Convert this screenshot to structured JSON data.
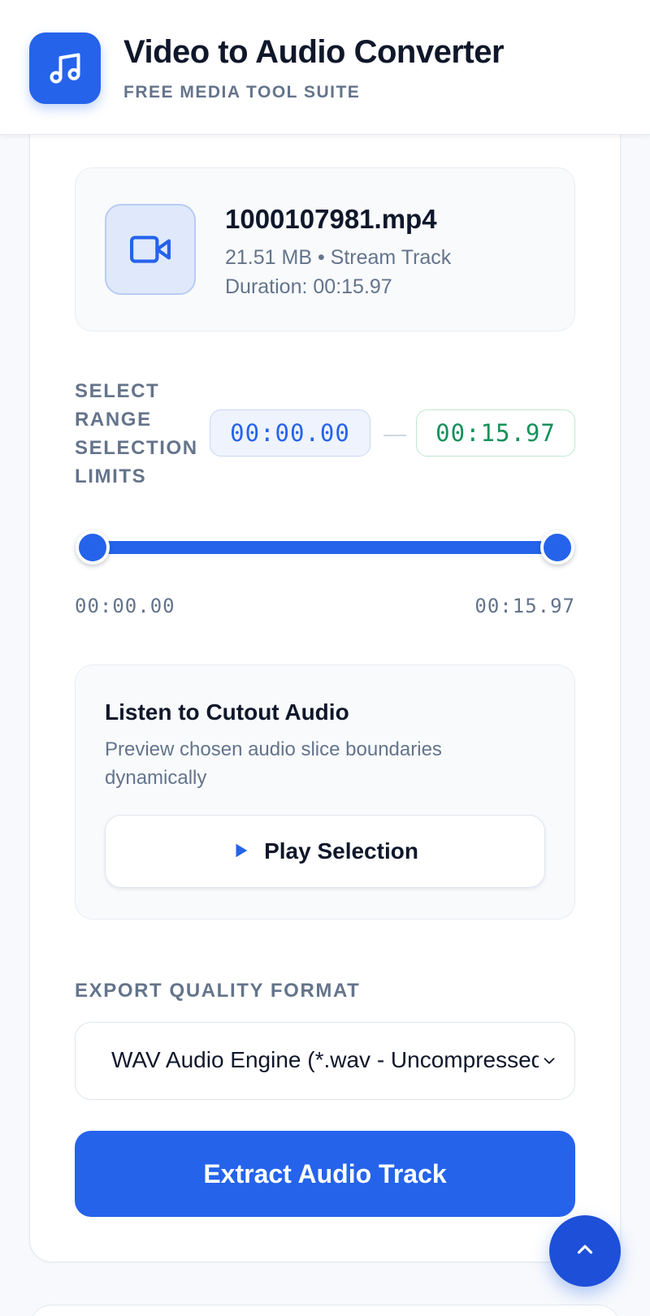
{
  "header": {
    "title": "Video to Audio Converter",
    "subtitle": "FREE MEDIA TOOL SUITE",
    "logo_icon": "music-note-icon"
  },
  "file": {
    "icon": "video-camera-icon",
    "name": "1000107981.mp4",
    "meta": "21.51 MB • Stream Track",
    "duration": "Duration: 00:15.97"
  },
  "range": {
    "label": "SELECT RANGE SELECTION LIMITS",
    "start": "00:00.00",
    "separator": "—",
    "end": "00:15.97",
    "slider_min": "00:00.00",
    "slider_max": "00:15.97",
    "start_fraction": 0,
    "end_fraction": 1
  },
  "preview": {
    "title": "Listen to Cutout Audio",
    "description": "Preview chosen audio slice boundaries dynamically",
    "play_label": "Play Selection",
    "play_icon": "play-icon"
  },
  "export": {
    "label": "EXPORT QUALITY FORMAT",
    "selected_format": "WAV Audio Engine (*.wav - Uncompressed)",
    "extract_label": "Extract Audio Track"
  },
  "colors": {
    "accent": "#2563eb",
    "end_time": "#16915a",
    "muted_text": "#64748b"
  }
}
